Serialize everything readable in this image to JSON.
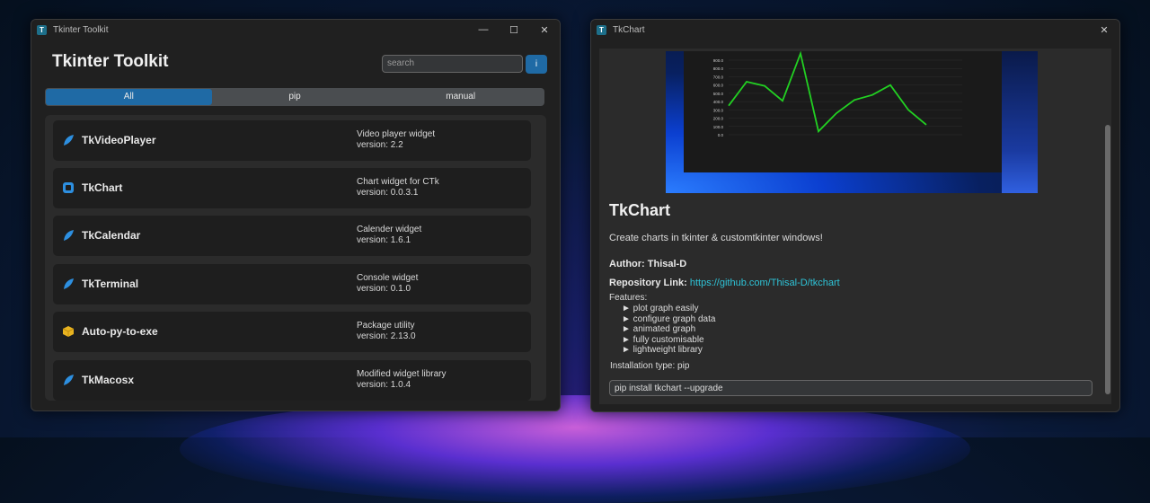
{
  "left_window": {
    "title": "Tkinter Toolkit",
    "app_title": "Tkinter Toolkit",
    "search_placeholder": "search",
    "info_button": "i",
    "filters": [
      "All",
      "pip",
      "manual"
    ],
    "packages": [
      {
        "name": "TkVideoPlayer",
        "desc": "Video player widget",
        "version": "version: 2.2",
        "icon": "leaf-icon"
      },
      {
        "name": "TkChart",
        "desc": "Chart widget for CTk",
        "version": "version: 0.0.3.1",
        "icon": "square-icon"
      },
      {
        "name": "TkCalendar",
        "desc": "Calender widget",
        "version": "version: 1.6.1",
        "icon": "leaf-icon"
      },
      {
        "name": "TkTerminal",
        "desc": "Console widget",
        "version": "version: 0.1.0",
        "icon": "leaf-icon"
      },
      {
        "name": "Auto-py-to-exe",
        "desc": "Package utility",
        "version": "version: 2.13.0",
        "icon": "cube-icon"
      },
      {
        "name": "TkMacosx",
        "desc": "Modified widget library",
        "version": "version: 1.0.4",
        "icon": "leaf-icon"
      }
    ]
  },
  "right_window": {
    "title": "TkChart",
    "pkg_title": "TkChart",
    "description": "Create charts in tkinter & customtkinter windows!",
    "author": "Author: Thisal-D",
    "repo_label": "Repository Link: ",
    "repo_url": "https://github.com/Thisal-D/tkchart",
    "features_heading": "Features:",
    "features": [
      "► plot graph easily",
      "► configure graph data",
      "► animated graph",
      "► fully customisable",
      "► lightweight library"
    ],
    "install_type": "Installation type: pip",
    "install_cmd": "pip install tkchart --upgrade"
  },
  "preview_chart": {
    "y_ticks": [
      "900.0",
      "800.0",
      "700.0",
      "600.0",
      "500.0",
      "400.0",
      "300.0",
      "200.0",
      "100.0",
      "0.0"
    ],
    "values": [
      350,
      640,
      590,
      410,
      980,
      40,
      260,
      420,
      480,
      600,
      300,
      120
    ],
    "ymax": 900,
    "line_color": "#22d022"
  }
}
